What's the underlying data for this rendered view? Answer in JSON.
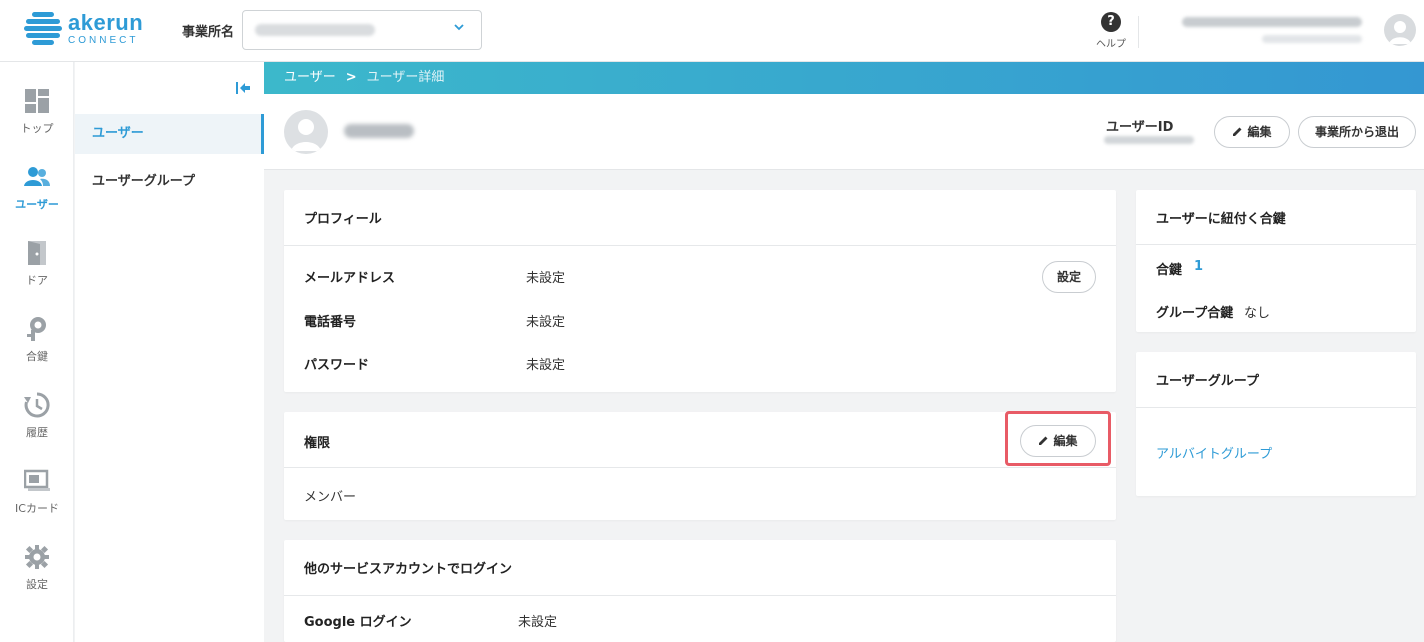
{
  "header": {
    "logo_text": "akerun",
    "logo_subtext": "CONNECT",
    "office_label": "事業所名",
    "help_label": "ヘルプ"
  },
  "rail": {
    "items": [
      {
        "label": "トップ",
        "icon": "dashboard-icon"
      },
      {
        "label": "ユーザー",
        "icon": "users-icon",
        "active": true
      },
      {
        "label": "ドア",
        "icon": "door-icon"
      },
      {
        "label": "合鍵",
        "icon": "key-icon"
      },
      {
        "label": "履歴",
        "icon": "history-icon"
      },
      {
        "label": "ICカード",
        "icon": "ic-card-icon"
      },
      {
        "label": "設定",
        "icon": "gear-icon"
      }
    ]
  },
  "subnav": {
    "items": [
      {
        "label": "ユーザー",
        "active": true
      },
      {
        "label": "ユーザーグループ"
      }
    ]
  },
  "breadcrumb": {
    "root": "ユーザー",
    "separator": ">",
    "current": "ユーザー詳細"
  },
  "user_bar": {
    "id_label": "ユーザーID",
    "edit_label": "編集",
    "leave_label": "事業所から退出"
  },
  "profile": {
    "title": "プロフィール",
    "set_button": "設定",
    "rows": [
      {
        "label": "メールアドレス",
        "value": "未設定"
      },
      {
        "label": "電話番号",
        "value": "未設定"
      },
      {
        "label": "パスワード",
        "value": "未設定"
      }
    ]
  },
  "permission": {
    "title": "権限",
    "edit_label": "編集",
    "value": "メンバー"
  },
  "other_login": {
    "title": "他のサービスアカウントでログイン",
    "rows": [
      {
        "label": "Google ログイン",
        "value": "未設定"
      }
    ]
  },
  "keys": {
    "title": "ユーザーに紐付く合鍵",
    "key_label": "合鍵",
    "key_value": "1",
    "group_key_label": "グループ合鍵",
    "group_key_value": "なし"
  },
  "user_group": {
    "title": "ユーザーグループ",
    "link": "アルバイトグループ"
  },
  "colors": {
    "accent": "#2e9bd6",
    "highlight": "#e85b66"
  }
}
